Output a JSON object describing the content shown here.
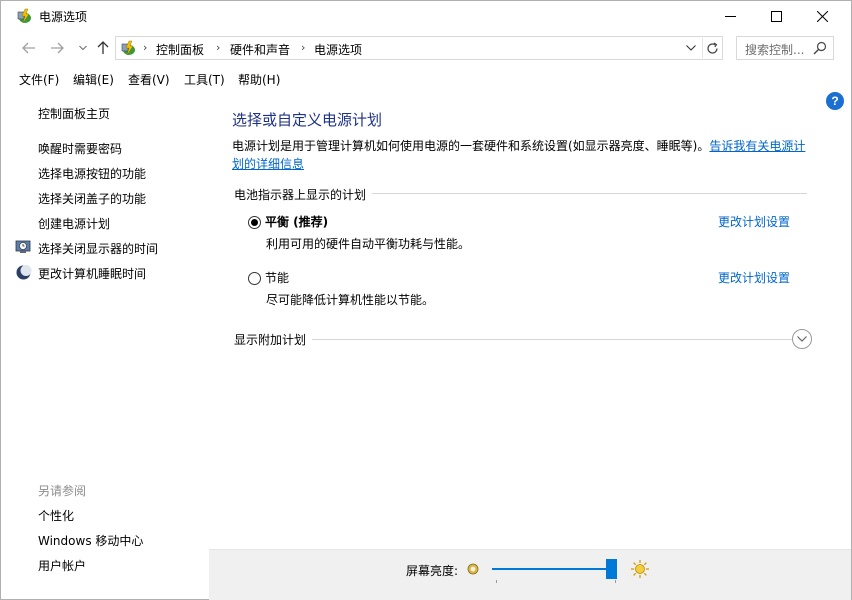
{
  "window": {
    "title": "电源选项",
    "controls": {
      "minimize": "minimize",
      "maximize": "maximize",
      "close": "close"
    }
  },
  "address_bar": {
    "breadcrumbs": [
      "控制面板",
      "硬件和声音",
      "电源选项"
    ],
    "search_placeholder": "搜索控制..."
  },
  "menu": [
    "文件(F)",
    "编辑(E)",
    "查看(V)",
    "工具(T)",
    "帮助(H)"
  ],
  "sidebar": {
    "home": "控制面板主页",
    "links": [
      "唤醒时需要密码",
      "选择电源按钮的功能",
      "选择关闭盖子的功能",
      "创建电源计划",
      "选择关闭显示器的时间",
      "更改计算机睡眠时间"
    ],
    "see_also_heading": "另请参阅",
    "see_also": [
      "个性化",
      "Windows 移动中心",
      "用户帐户"
    ]
  },
  "main": {
    "title": "选择或自定义电源计划",
    "description_line1": "电源计划是用于管理计算机如何使用电源的一套硬件和系统设置(如显示器亮度、睡眠等)。",
    "description_link_part1": "告诉我有关电源计",
    "description_link_part2": "划的详细信息",
    "group_title": "电池指示器上显示的计划",
    "plans": [
      {
        "name": "平衡 (推荐)",
        "description": "利用可用的硬件自动平衡功耗与性能。",
        "selected": true,
        "link": "更改计划设置"
      },
      {
        "name": "节能",
        "description": "尽可能降低计算机性能以节能。",
        "selected": false,
        "link": "更改计划设置"
      }
    ],
    "extra_plans": "显示附加计划",
    "help": "?"
  },
  "brightness": {
    "label": "屏幕亮度:",
    "level_percent": 100
  },
  "colors": {
    "accent": "#0078d7",
    "link": "#0066cc",
    "title": "#1e3287"
  }
}
